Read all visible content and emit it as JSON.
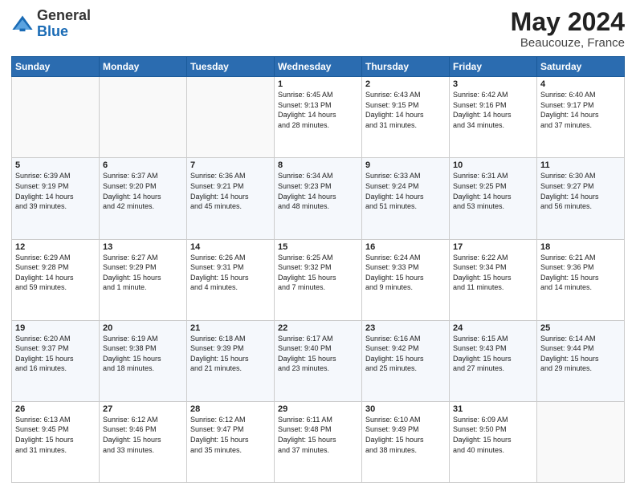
{
  "logo": {
    "general": "General",
    "blue": "Blue"
  },
  "title": {
    "month_year": "May 2024",
    "location": "Beaucouze, France"
  },
  "header_days": [
    "Sunday",
    "Monday",
    "Tuesday",
    "Wednesday",
    "Thursday",
    "Friday",
    "Saturday"
  ],
  "weeks": [
    [
      {
        "day": "",
        "info": ""
      },
      {
        "day": "",
        "info": ""
      },
      {
        "day": "",
        "info": ""
      },
      {
        "day": "1",
        "info": "Sunrise: 6:45 AM\nSunset: 9:13 PM\nDaylight: 14 hours\nand 28 minutes."
      },
      {
        "day": "2",
        "info": "Sunrise: 6:43 AM\nSunset: 9:15 PM\nDaylight: 14 hours\nand 31 minutes."
      },
      {
        "day": "3",
        "info": "Sunrise: 6:42 AM\nSunset: 9:16 PM\nDaylight: 14 hours\nand 34 minutes."
      },
      {
        "day": "4",
        "info": "Sunrise: 6:40 AM\nSunset: 9:17 PM\nDaylight: 14 hours\nand 37 minutes."
      }
    ],
    [
      {
        "day": "5",
        "info": "Sunrise: 6:39 AM\nSunset: 9:19 PM\nDaylight: 14 hours\nand 39 minutes."
      },
      {
        "day": "6",
        "info": "Sunrise: 6:37 AM\nSunset: 9:20 PM\nDaylight: 14 hours\nand 42 minutes."
      },
      {
        "day": "7",
        "info": "Sunrise: 6:36 AM\nSunset: 9:21 PM\nDaylight: 14 hours\nand 45 minutes."
      },
      {
        "day": "8",
        "info": "Sunrise: 6:34 AM\nSunset: 9:23 PM\nDaylight: 14 hours\nand 48 minutes."
      },
      {
        "day": "9",
        "info": "Sunrise: 6:33 AM\nSunset: 9:24 PM\nDaylight: 14 hours\nand 51 minutes."
      },
      {
        "day": "10",
        "info": "Sunrise: 6:31 AM\nSunset: 9:25 PM\nDaylight: 14 hours\nand 53 minutes."
      },
      {
        "day": "11",
        "info": "Sunrise: 6:30 AM\nSunset: 9:27 PM\nDaylight: 14 hours\nand 56 minutes."
      }
    ],
    [
      {
        "day": "12",
        "info": "Sunrise: 6:29 AM\nSunset: 9:28 PM\nDaylight: 14 hours\nand 59 minutes."
      },
      {
        "day": "13",
        "info": "Sunrise: 6:27 AM\nSunset: 9:29 PM\nDaylight: 15 hours\nand 1 minute."
      },
      {
        "day": "14",
        "info": "Sunrise: 6:26 AM\nSunset: 9:31 PM\nDaylight: 15 hours\nand 4 minutes."
      },
      {
        "day": "15",
        "info": "Sunrise: 6:25 AM\nSunset: 9:32 PM\nDaylight: 15 hours\nand 7 minutes."
      },
      {
        "day": "16",
        "info": "Sunrise: 6:24 AM\nSunset: 9:33 PM\nDaylight: 15 hours\nand 9 minutes."
      },
      {
        "day": "17",
        "info": "Sunrise: 6:22 AM\nSunset: 9:34 PM\nDaylight: 15 hours\nand 11 minutes."
      },
      {
        "day": "18",
        "info": "Sunrise: 6:21 AM\nSunset: 9:36 PM\nDaylight: 15 hours\nand 14 minutes."
      }
    ],
    [
      {
        "day": "19",
        "info": "Sunrise: 6:20 AM\nSunset: 9:37 PM\nDaylight: 15 hours\nand 16 minutes."
      },
      {
        "day": "20",
        "info": "Sunrise: 6:19 AM\nSunset: 9:38 PM\nDaylight: 15 hours\nand 18 minutes."
      },
      {
        "day": "21",
        "info": "Sunrise: 6:18 AM\nSunset: 9:39 PM\nDaylight: 15 hours\nand 21 minutes."
      },
      {
        "day": "22",
        "info": "Sunrise: 6:17 AM\nSunset: 9:40 PM\nDaylight: 15 hours\nand 23 minutes."
      },
      {
        "day": "23",
        "info": "Sunrise: 6:16 AM\nSunset: 9:42 PM\nDaylight: 15 hours\nand 25 minutes."
      },
      {
        "day": "24",
        "info": "Sunrise: 6:15 AM\nSunset: 9:43 PM\nDaylight: 15 hours\nand 27 minutes."
      },
      {
        "day": "25",
        "info": "Sunrise: 6:14 AM\nSunset: 9:44 PM\nDaylight: 15 hours\nand 29 minutes."
      }
    ],
    [
      {
        "day": "26",
        "info": "Sunrise: 6:13 AM\nSunset: 9:45 PM\nDaylight: 15 hours\nand 31 minutes."
      },
      {
        "day": "27",
        "info": "Sunrise: 6:12 AM\nSunset: 9:46 PM\nDaylight: 15 hours\nand 33 minutes."
      },
      {
        "day": "28",
        "info": "Sunrise: 6:12 AM\nSunset: 9:47 PM\nDaylight: 15 hours\nand 35 minutes."
      },
      {
        "day": "29",
        "info": "Sunrise: 6:11 AM\nSunset: 9:48 PM\nDaylight: 15 hours\nand 37 minutes."
      },
      {
        "day": "30",
        "info": "Sunrise: 6:10 AM\nSunset: 9:49 PM\nDaylight: 15 hours\nand 38 minutes."
      },
      {
        "day": "31",
        "info": "Sunrise: 6:09 AM\nSunset: 9:50 PM\nDaylight: 15 hours\nand 40 minutes."
      },
      {
        "day": "",
        "info": ""
      }
    ]
  ]
}
